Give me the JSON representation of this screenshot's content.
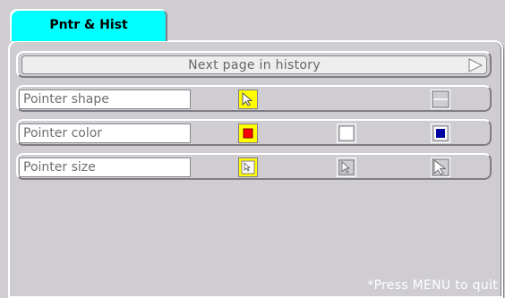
{
  "tab": {
    "label": "Pntr & Hist"
  },
  "next_page": {
    "label": "Next page in history"
  },
  "rows": {
    "shape": {
      "label": "Pointer shape"
    },
    "color": {
      "label": "Pointer color"
    },
    "size": {
      "label": "Pointer size"
    }
  },
  "colors": {
    "tab": "#00ffff",
    "selected": "#ffff00",
    "red": "#ff0000",
    "blue": "#0000a0",
    "background": "#cfcdd2"
  },
  "footer": {
    "note": "*Press MENU to quit"
  }
}
